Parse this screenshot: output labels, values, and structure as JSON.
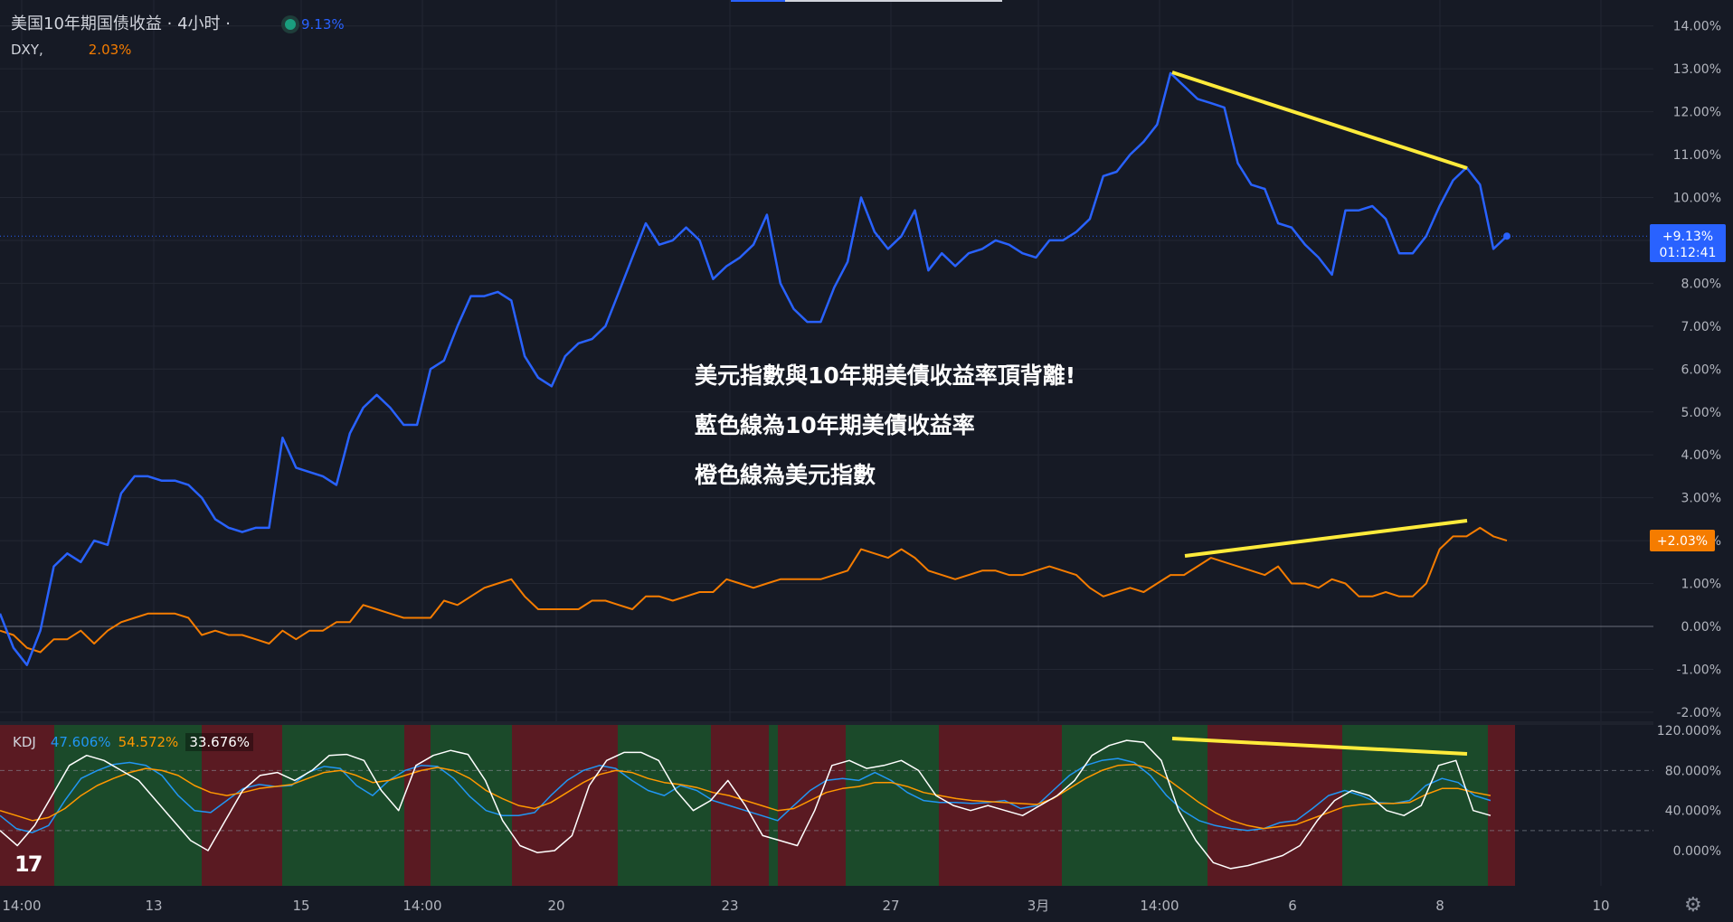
{
  "legend": {
    "title": "美国10年期国债收益 · 4小时 ·",
    "main_pct": "9.13%",
    "dxy_label": "DXY,",
    "dxy_pct": "2.03%"
  },
  "annotations": [
    "美元指數與10年期美債收益率頂背離!",
    "藍色線為10年期美債收益率",
    "橙色線為美元指數"
  ],
  "badges": {
    "main_value": "+9.13%",
    "main_countdown": "01:12:41",
    "dxy_value": "+2.03%"
  },
  "colors": {
    "background": "#161a25",
    "yield_line": "#2962ff",
    "dxy_line": "#f57c00",
    "k_line": "#2196f3",
    "d_line": "#ff9800",
    "j_line": "#ffffff",
    "trendline": "#ffeb3b",
    "kdj_bull_bg": "#1b4a2a",
    "kdj_bear_bg": "#5a1a22"
  },
  "kdj": {
    "label": "KDJ",
    "k": "47.606%",
    "d": "54.572%",
    "j": "33.676%"
  },
  "logo": "17",
  "chart_data": [
    {
      "type": "line",
      "title": "美国10年期国债收益 · 4小时 ·",
      "x_ticks": [
        "14:00",
        "13",
        "15",
        "14:00",
        "20",
        "23",
        "27",
        "3月",
        "14:00",
        "6",
        "8",
        "10"
      ],
      "y_ticks": [
        "14.00%",
        "13.00%",
        "12.00%",
        "11.00%",
        "10.00%",
        "9.00%",
        "8.00%",
        "7.00%",
        "6.00%",
        "5.00%",
        "4.00%",
        "3.00%",
        "2.00%",
        "1.00%",
        "0.00%",
        "-1.00%",
        "-2.00%"
      ],
      "ylim": [
        -2.2,
        14.5
      ],
      "series": [
        {
          "name": "美国10年期国债收益",
          "values": [
            0.3,
            -0.5,
            -0.9,
            -0.1,
            1.4,
            1.7,
            1.5,
            2.0,
            1.9,
            3.1,
            3.5,
            3.5,
            3.4,
            3.4,
            3.3,
            3.0,
            2.5,
            2.3,
            2.2,
            2.3,
            2.3,
            4.4,
            3.7,
            3.6,
            3.5,
            3.3,
            4.5,
            5.1,
            5.4,
            5.1,
            4.7,
            4.7,
            6.0,
            6.2,
            7.0,
            7.7,
            7.7,
            7.8,
            7.6,
            6.3,
            5.8,
            5.6,
            6.3,
            6.6,
            6.7,
            7.0,
            7.8,
            8.6,
            9.4,
            8.9,
            9.0,
            9.3,
            9.0,
            8.1,
            8.4,
            8.6,
            8.9,
            9.6,
            8.0,
            7.4,
            7.1,
            7.1,
            7.9,
            8.5,
            10.0,
            9.2,
            8.8,
            9.1,
            9.7,
            8.3,
            8.7,
            8.4,
            8.7,
            8.8,
            9.0,
            8.9,
            8.7,
            8.6,
            9.0,
            9.0,
            9.2,
            9.5,
            10.5,
            10.6,
            11.0,
            11.3,
            11.7,
            12.9,
            12.6,
            12.3,
            12.2,
            12.1,
            10.8,
            10.3,
            10.2,
            9.4,
            9.3,
            8.9,
            8.6,
            8.2,
            9.7,
            9.7,
            9.8,
            9.5,
            8.7,
            8.7,
            9.1,
            9.8,
            10.4,
            10.7,
            10.3,
            8.8,
            9.1
          ]
        },
        {
          "name": "DXY",
          "values": [
            -0.1,
            -0.2,
            -0.5,
            -0.6,
            -0.3,
            -0.3,
            -0.1,
            -0.4,
            -0.1,
            0.1,
            0.2,
            0.3,
            0.3,
            0.3,
            0.2,
            -0.2,
            -0.1,
            -0.2,
            -0.2,
            -0.3,
            -0.4,
            -0.1,
            -0.3,
            -0.1,
            -0.1,
            0.1,
            0.1,
            0.5,
            0.4,
            0.3,
            0.2,
            0.2,
            0.2,
            0.6,
            0.5,
            0.7,
            0.9,
            1.0,
            1.1,
            0.7,
            0.4,
            0.4,
            0.4,
            0.4,
            0.6,
            0.6,
            0.5,
            0.4,
            0.7,
            0.7,
            0.6,
            0.7,
            0.8,
            0.8,
            1.1,
            1.0,
            0.9,
            1.0,
            1.1,
            1.1,
            1.1,
            1.1,
            1.2,
            1.3,
            1.8,
            1.7,
            1.6,
            1.8,
            1.6,
            1.3,
            1.2,
            1.1,
            1.2,
            1.3,
            1.3,
            1.2,
            1.2,
            1.3,
            1.4,
            1.3,
            1.2,
            0.9,
            0.7,
            0.8,
            0.9,
            0.8,
            1.0,
            1.2,
            1.2,
            1.4,
            1.6,
            1.5,
            1.4,
            1.3,
            1.2,
            1.4,
            1.0,
            1.0,
            0.9,
            1.1,
            1.0,
            0.7,
            0.7,
            0.8,
            0.7,
            0.7,
            1.0,
            1.8,
            2.1,
            2.1,
            2.3,
            2.1,
            2.0
          ]
        }
      ]
    },
    {
      "type": "line",
      "title": "KDJ",
      "y_ticks": [
        "120.000%",
        "80.000%",
        "40.000%",
        "0.000%"
      ],
      "ylim": [
        -38,
        126
      ],
      "series": [
        {
          "name": "47.606%",
          "values": [
            35,
            22,
            18,
            25,
            50,
            72,
            80,
            86,
            88,
            85,
            75,
            55,
            40,
            38,
            50,
            62,
            66,
            64,
            65,
            78,
            84,
            82,
            65,
            55,
            70,
            80,
            85,
            84,
            72,
            54,
            40,
            35,
            35,
            38,
            55,
            70,
            80,
            85,
            82,
            70,
            60,
            55,
            65,
            60,
            50,
            45,
            40,
            35,
            30,
            45,
            60,
            70,
            72,
            70,
            78,
            70,
            58,
            50,
            48,
            48,
            47,
            48,
            50,
            42,
            45,
            60,
            75,
            85,
            90,
            92,
            88,
            75,
            55,
            40,
            30,
            25,
            22,
            20,
            22,
            28,
            30,
            42,
            55,
            60,
            55,
            48,
            47,
            50,
            65,
            72,
            68,
            55,
            50
          ]
        },
        {
          "name": "54.572%",
          "values": [
            40,
            35,
            30,
            33,
            42,
            55,
            65,
            72,
            78,
            82,
            80,
            75,
            65,
            58,
            55,
            58,
            62,
            64,
            66,
            72,
            78,
            80,
            75,
            68,
            70,
            75,
            80,
            83,
            80,
            72,
            60,
            52,
            45,
            42,
            48,
            58,
            68,
            76,
            80,
            78,
            72,
            68,
            66,
            63,
            58,
            55,
            50,
            45,
            40,
            42,
            50,
            58,
            62,
            64,
            68,
            68,
            64,
            58,
            55,
            52,
            50,
            49,
            48,
            47,
            46,
            52,
            62,
            72,
            80,
            85,
            86,
            82,
            72,
            60,
            48,
            38,
            30,
            25,
            22,
            24,
            26,
            32,
            38,
            44,
            46,
            47,
            47,
            48,
            56,
            62,
            62,
            58,
            55
          ]
        },
        {
          "name": "33.676%",
          "values": [
            20,
            5,
            25,
            55,
            85,
            95,
            90,
            80,
            70,
            50,
            30,
            10,
            0,
            30,
            60,
            75,
            78,
            70,
            80,
            95,
            96,
            90,
            60,
            40,
            85,
            95,
            100,
            96,
            70,
            30,
            5,
            -2,
            0,
            15,
            65,
            90,
            98,
            98,
            90,
            60,
            40,
            50,
            70,
            45,
            15,
            10,
            5,
            40,
            85,
            90,
            82,
            85,
            90,
            80,
            55,
            45,
            40,
            45,
            40,
            35,
            45,
            55,
            70,
            95,
            105,
            110,
            108,
            90,
            40,
            10,
            -12,
            -18,
            -15,
            -10,
            -5,
            5,
            30,
            50,
            60,
            55,
            40,
            35,
            45,
            85,
            90,
            40,
            35
          ]
        }
      ]
    }
  ]
}
